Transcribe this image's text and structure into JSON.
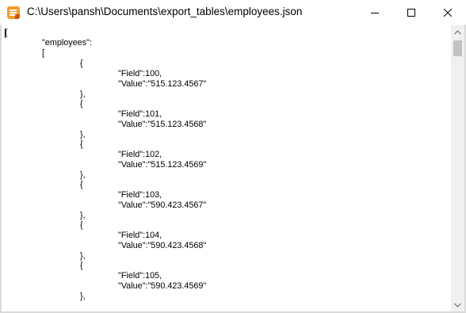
{
  "window": {
    "title": "C:\\Users\\pansh\\Documents\\export_tables\\employees.json",
    "buttons": {
      "minimize": "minimize",
      "maximize": "maximize",
      "close": "close"
    }
  },
  "editor": {
    "lines": [
      "{",
      "\"employees\":",
      "[",
      "{",
      "\"Field\":100,",
      "\"Value\":\"515.123.4567\"",
      "},",
      "{",
      "\"Field\":101,",
      "\"Value\":\"515.123.4568\"",
      "},",
      "{",
      "\"Field\":102,",
      "\"Value\":\"515.123.4569\"",
      "},",
      "{",
      "\"Field\":103,",
      "\"Value\":\"590.423.4567\"",
      "},",
      "{",
      "\"Field\":104,",
      "\"Value\":\"590.423.4568\"",
      "},",
      "{",
      "\"Field\":105,",
      "\"Value\":\"590.423.4569\"",
      "},"
    ]
  },
  "scrollbar": {
    "position": 0.02
  }
}
